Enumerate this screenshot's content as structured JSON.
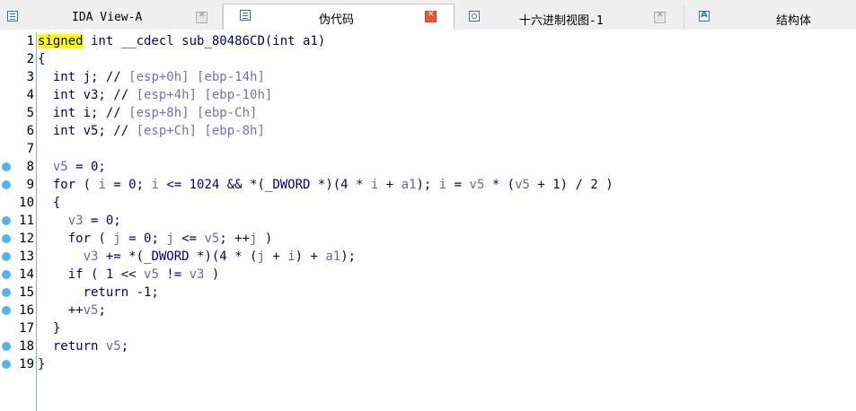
{
  "tabs": [
    {
      "label": "IDA View-A",
      "icon": "doc-icon",
      "active": false
    },
    {
      "label": "伪代码",
      "icon": "doc-icon",
      "active": true
    },
    {
      "label": "十六进制视图-1",
      "icon": "hex-icon",
      "active": false
    },
    {
      "label": "结构体",
      "icon": "struct-icon",
      "active": false
    }
  ],
  "colors": {
    "keyword": "#000080",
    "variable": "#6464c8",
    "highlight": "#ffff00",
    "breakpoint": "#4fb7ee",
    "active_close": "#e8593a"
  },
  "code": {
    "line_numbers": [
      "1",
      "2",
      "3",
      "4",
      "5",
      "6",
      "7",
      "8",
      "9",
      "10",
      "11",
      "12",
      "13",
      "14",
      "15",
      "16",
      "17",
      "18",
      "19"
    ],
    "l1": {
      "hl": "signed",
      "rest": " int __cdecl sub_80486CD(int a1)"
    },
    "l2": "{",
    "l3": {
      "decl": "  int j; // ",
      "c1": "[esp+0h] [ebp-14h]"
    },
    "l4": {
      "decl": "  int v3; // ",
      "c1": "[esp+4h] [ebp-10h]"
    },
    "l5": {
      "decl": "  int i; // ",
      "c1": "[esp+8h] [ebp-Ch]"
    },
    "l6": {
      "decl": "  int v5; // ",
      "c1": "[esp+Ch] [ebp-8h]"
    },
    "l8": {
      "a": "  ",
      "v": "v5",
      "b": " = 0;"
    },
    "l9": {
      "p1": "  for ( ",
      "v1": "i",
      "p2": " = 0; ",
      "v2": "i",
      "p3": " <= 1024 && *(_DWORD *)(4 * ",
      "v3": "i",
      "p4": " + ",
      "v4": "a1",
      "p5": "); ",
      "v5": "i",
      "p6": " = ",
      "v6": "v5",
      "p7": " * (",
      "v7": "v5",
      "p8": " + 1) / 2 )"
    },
    "l10": "  {",
    "l11": {
      "a": "    ",
      "v": "v3",
      "b": " = 0;"
    },
    "l12": {
      "p1": "    for ( ",
      "v1": "j",
      "p2": " = 0; ",
      "v2": "j",
      "p3": " <= ",
      "v3": "v5",
      "p4": "; ++",
      "v4": "j",
      "p5": " )"
    },
    "l13": {
      "p1": "      ",
      "v1": "v3",
      "p2": " += *(_DWORD *)(4 * (",
      "v2": "j",
      "p3": " + ",
      "v3": "i",
      "p4": ") + ",
      "v4": "a1",
      "p5": ");"
    },
    "l14": {
      "p1": "    if ( 1 << ",
      "v1": "v5",
      "p2": " != ",
      "v2": "v3",
      "p3": " )"
    },
    "l15": "      return -1;",
    "l16": {
      "p1": "    ++",
      "v1": "v5",
      "p2": ";"
    },
    "l17": "  }",
    "l18": {
      "p1": "  return ",
      "v1": "v5",
      "p2": ";"
    },
    "l19": "}"
  }
}
